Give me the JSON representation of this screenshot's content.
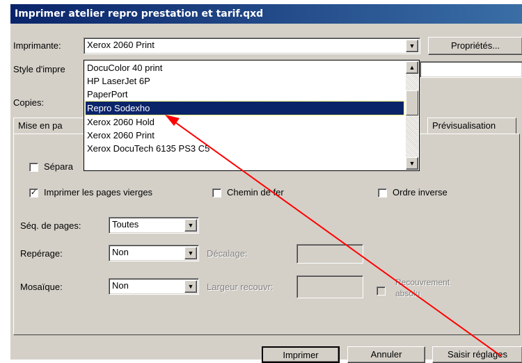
{
  "window": {
    "title": "Imprimer atelier repro prestation et tarif.qxd"
  },
  "printer": {
    "label": "Imprimante:",
    "value": "Xerox 2060 Print",
    "properties_button": "Propriétés...",
    "options": [
      "DocuColor 40 print",
      "HP LaserJet 6P",
      "PaperPort",
      "Repro Sodexho",
      "Xerox 2060 Hold",
      "Xerox 2060 Print",
      "Xerox DocuTech 6135 PS3 C5"
    ],
    "highlighted": "Repro Sodexho"
  },
  "style": {
    "label": "Style d'impre"
  },
  "copies": {
    "label": "Copies:"
  },
  "tabs": {
    "layout": "Mise en pa",
    "preview": "Prévisualisation"
  },
  "options": {
    "separations_label": "Sépara",
    "blank_pages_label": "Imprimer les pages vierges",
    "blank_pages_checked": true,
    "thumbnails_label": "Chemin de fer",
    "reverse_label": "Ordre inverse"
  },
  "sequence": {
    "label": "Séq. de pages:",
    "value": "Toutes"
  },
  "registration": {
    "label": "Repérage:",
    "value": "Non",
    "offset_label": "Décalage:"
  },
  "tiling": {
    "label": "Mosaïque:",
    "value": "Non",
    "overlap_label": "Largeur recouvr:",
    "absolute_label_line1": "Recouvrement",
    "absolute_label_line2": "absolu"
  },
  "buttons": {
    "print": "Imprimer",
    "cancel": "Annuler",
    "capture": "Saisir réglages"
  },
  "annotation": {
    "color": "#ff0000"
  }
}
